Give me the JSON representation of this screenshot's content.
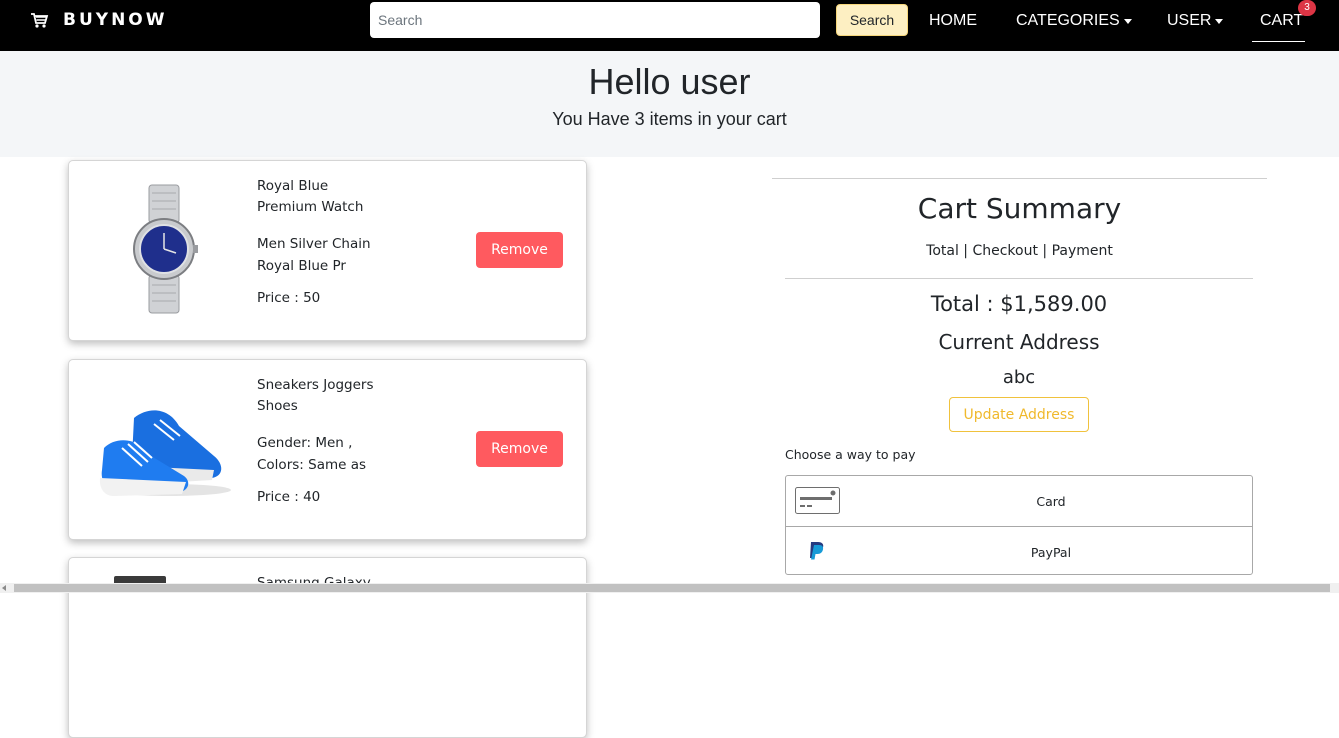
{
  "nav": {
    "brand": "BUYNOW",
    "search_placeholder": "Search",
    "search_button": "Search",
    "home": "HOME",
    "categories": "CATEGORIES",
    "user": "USER",
    "cart": "CART",
    "cart_count": "3"
  },
  "hero": {
    "greeting": "Hello user",
    "subtitle": "You Have 3 items in your cart"
  },
  "cart_items": [
    {
      "name_line1": "Royal Blue",
      "name_line2": "Premium Watch",
      "desc_line1": "Men Silver Chain",
      "desc_line2": "Royal Blue Pr",
      "price": "Price : 50",
      "remove": "Remove",
      "image_icon": "watch-image"
    },
    {
      "name_line1": "Sneakers Joggers",
      "name_line2": "Shoes",
      "desc_line1": "Gender: Men ,",
      "desc_line2": "Colors: Same as",
      "price": "Price : 40",
      "remove": "Remove",
      "image_icon": "sneaker-image"
    },
    {
      "name_line1": "Samsung Galaxy",
      "image_icon": "phone-image"
    }
  ],
  "summary": {
    "title": "Cart Summary",
    "subtitle": "Total | Checkout | Payment",
    "total": "Total : $1,589.00",
    "address_title": "Current Address",
    "address_value": "abc",
    "update_button": "Update Address",
    "pay_label": "Choose a way to pay",
    "pay_options": [
      {
        "label": "Card",
        "icon": "card-icon"
      },
      {
        "label": "PayPal",
        "icon": "paypal-icon"
      }
    ]
  },
  "colors": {
    "navbar": "#000000",
    "remove_button": "#ff5a5f",
    "update_border": "#f0c23d",
    "badge": "#dc3545",
    "search_button": "#fdefc2"
  }
}
